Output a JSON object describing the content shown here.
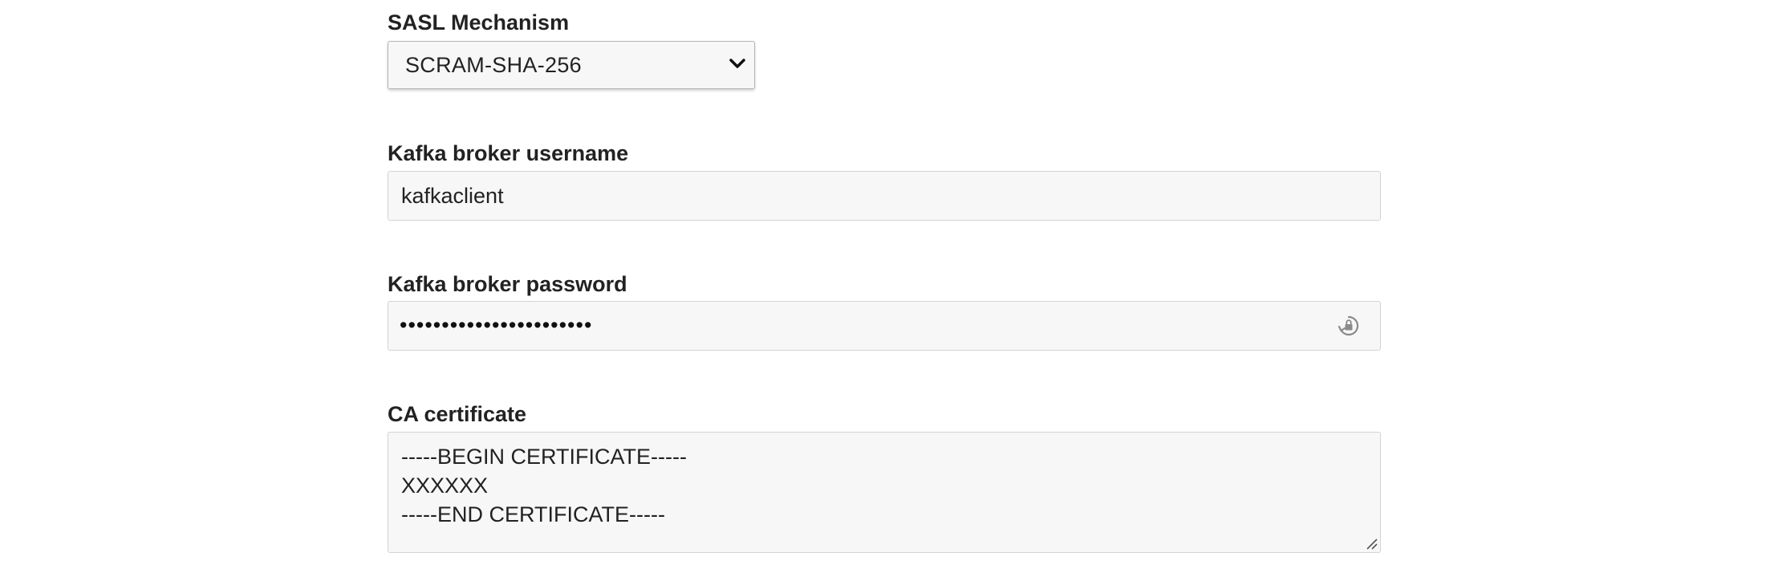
{
  "sasl": {
    "label": "SASL Mechanism",
    "selected": "SCRAM-SHA-256"
  },
  "username": {
    "label": "Kafka broker username",
    "value": "kafkaclient"
  },
  "password": {
    "label": "Kafka broker password",
    "masked_value": "•••••••••••••••••••••••",
    "reveal_icon": "lock-refresh-icon"
  },
  "ca_cert": {
    "label": "CA certificate",
    "lines": [
      "-----BEGIN CERTIFICATE-----",
      "XXXXXX",
      "-----END CERTIFICATE-----"
    ]
  }
}
